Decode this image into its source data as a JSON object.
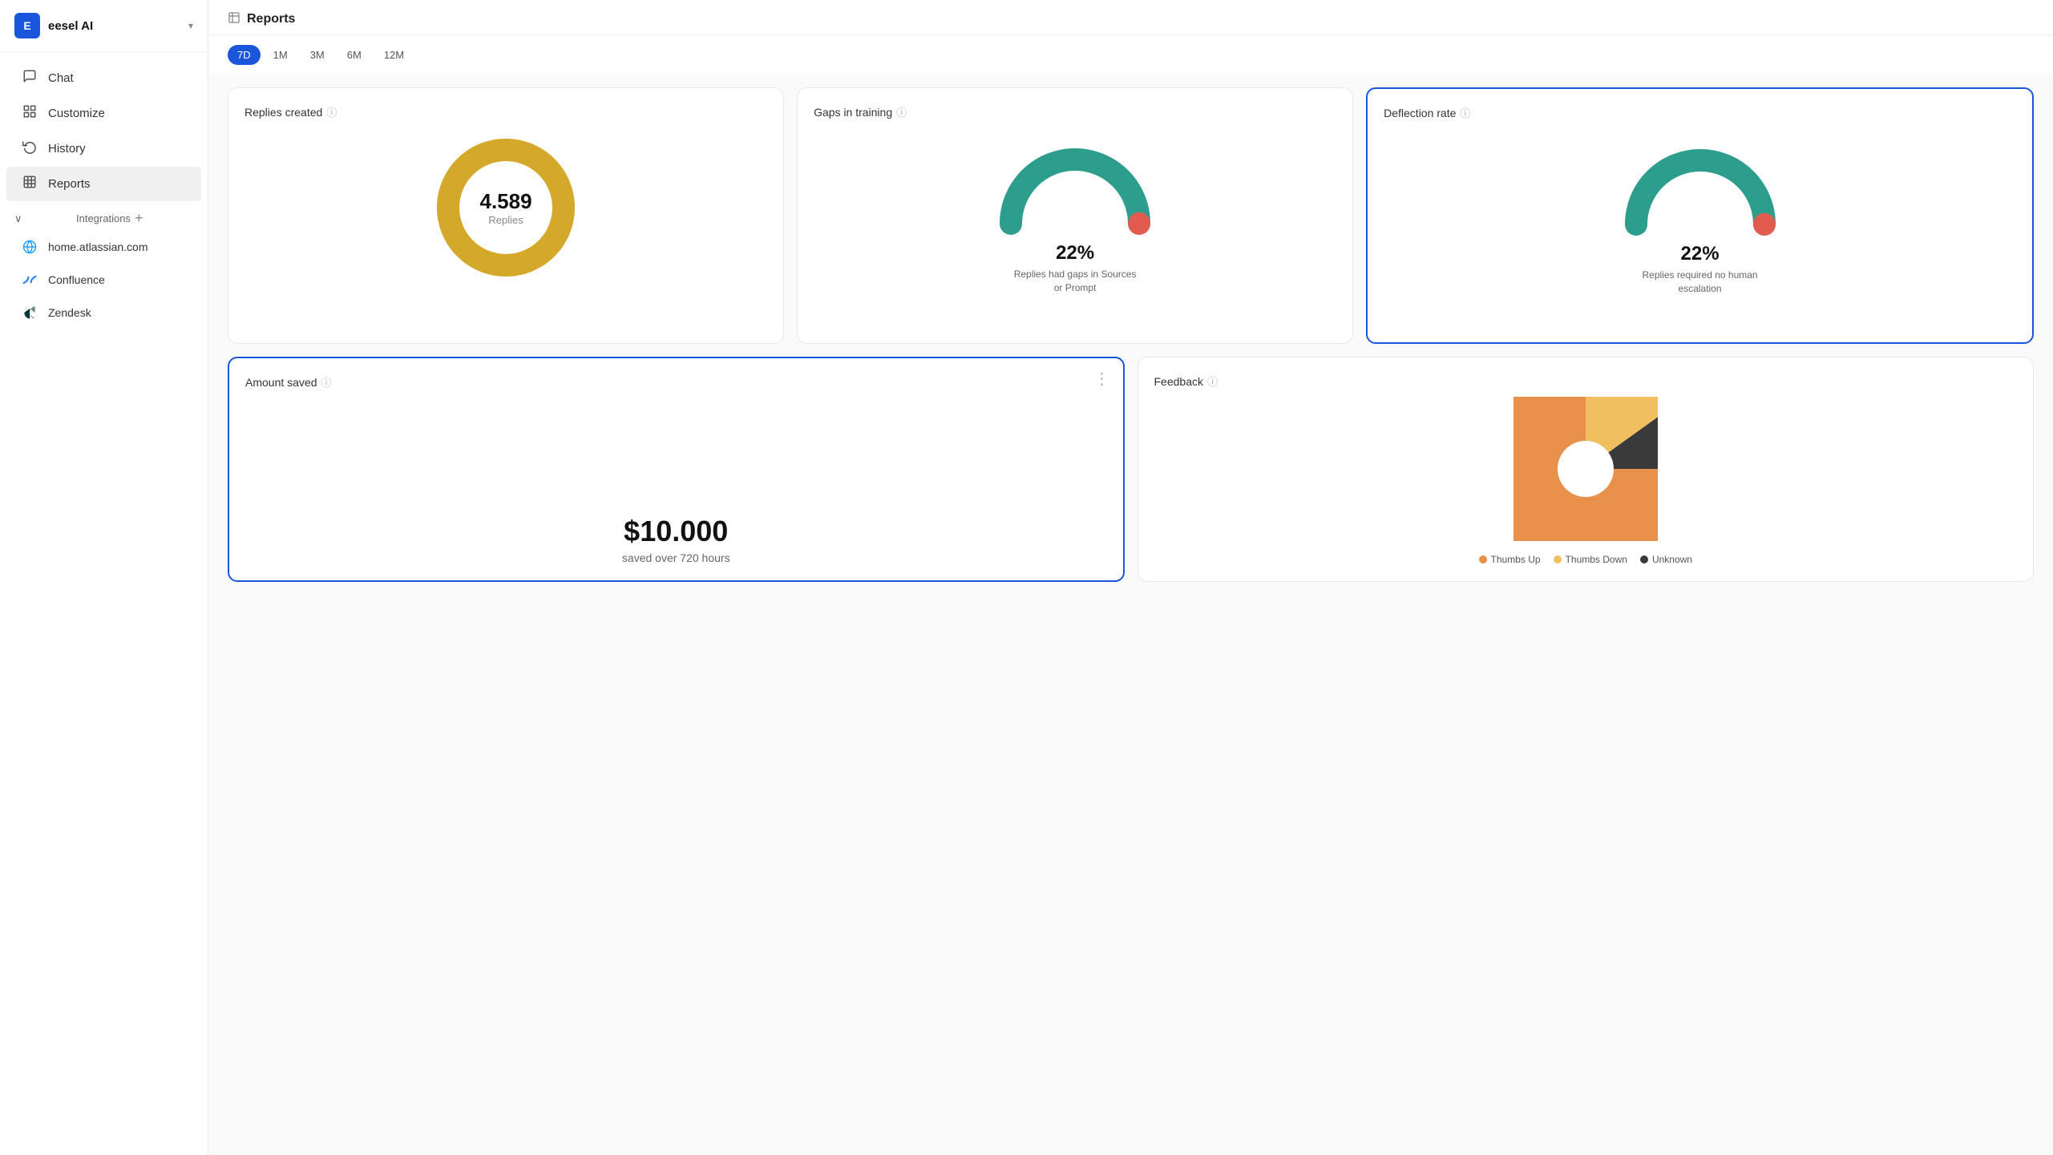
{
  "sidebar": {
    "app_name": "eesel AI",
    "avatar_letter": "E",
    "chevron": "▾",
    "nav_items": [
      {
        "id": "chat",
        "label": "Chat",
        "icon": "💬"
      },
      {
        "id": "customize",
        "label": "Customize",
        "icon": "⊞"
      },
      {
        "id": "history",
        "label": "History",
        "icon": "↺"
      },
      {
        "id": "reports",
        "label": "Reports",
        "icon": "▦",
        "active": true
      }
    ],
    "integrations_label": "Integrations",
    "integrations_add": "+",
    "integrations": [
      {
        "id": "atlassian",
        "label": "home.atlassian.com",
        "icon": "🌐"
      },
      {
        "id": "confluence",
        "label": "Confluence",
        "icon": "✕"
      },
      {
        "id": "zendesk",
        "label": "Zendesk",
        "icon": "Z"
      }
    ]
  },
  "header": {
    "icon": "📊",
    "title": "Reports"
  },
  "time_filters": [
    {
      "id": "7d",
      "label": "7D",
      "active": true
    },
    {
      "id": "1m",
      "label": "1M",
      "active": false
    },
    {
      "id": "3m",
      "label": "3M",
      "active": false
    },
    {
      "id": "6m",
      "label": "6M",
      "active": false
    },
    {
      "id": "12m",
      "label": "12M",
      "active": false
    }
  ],
  "cards": {
    "replies": {
      "title": "Replies created",
      "value": "4.589",
      "label": "Replies",
      "donut_color": "#d4a82a",
      "donut_bg": "#f0e0a0"
    },
    "gaps": {
      "title": "Gaps in training",
      "percent": "22%",
      "description": "Replies had gaps in Sources or Prompt",
      "gauge_main": "#2d9e8e",
      "gauge_accent": "#e05c4e"
    },
    "deflection": {
      "title": "Deflection rate",
      "percent": "22%",
      "description": "Replies required no human escalation",
      "gauge_main": "#2d9e8e",
      "gauge_accent": "#e05c4e",
      "selected": true
    },
    "amount_saved": {
      "title": "Amount saved",
      "value": "$10.000",
      "description": "saved over 720 hours",
      "selected": true
    },
    "feedback": {
      "title": "Feedback",
      "legend": [
        {
          "label": "Thumbs Up",
          "color": "#e8914a"
        },
        {
          "label": "Thumbs Down",
          "color": "#f0c060"
        },
        {
          "label": "Unknown",
          "color": "#3a3a3a"
        }
      ]
    }
  }
}
